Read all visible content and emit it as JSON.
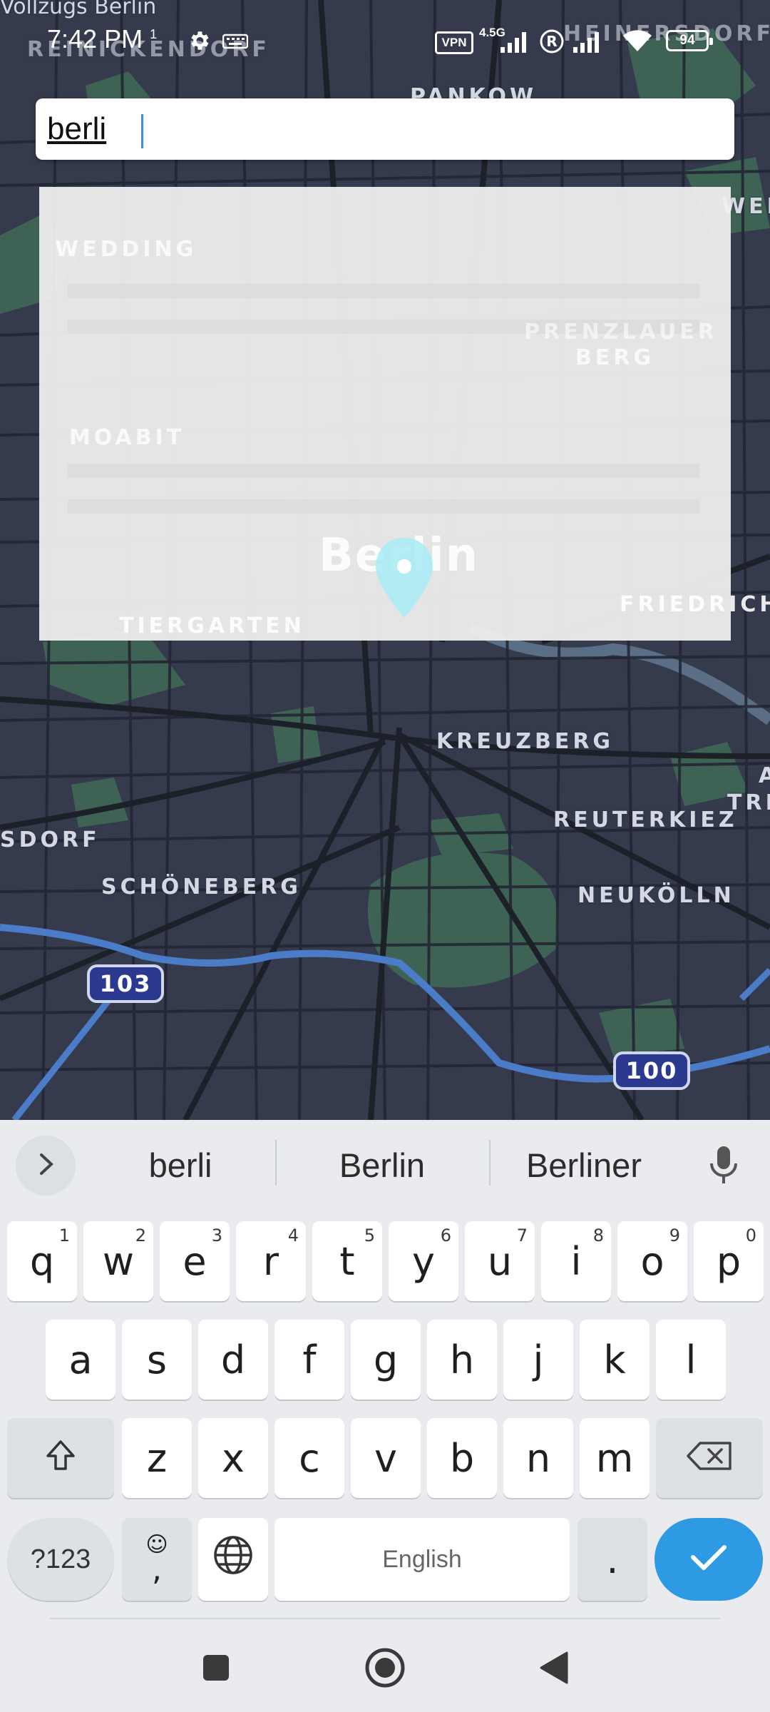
{
  "status_bar": {
    "time": "7:42 PM",
    "notif_badge": "1",
    "vpn_label": "VPN",
    "network_type": "4.5G",
    "battery_level": "94",
    "icons": [
      "settings-icon",
      "keyboard-icon",
      "signal-icon",
      "roaming-icon",
      "signal-icon",
      "wifi-icon",
      "battery-icon"
    ]
  },
  "map": {
    "labels": {
      "top": "Vollzugs Berlin",
      "reinickendorf": "REINICKENDORF",
      "pankow": "PANKOW",
      "heinersdorf": "HEINERSDORF",
      "wei": "WEI",
      "wedding": "WEDDING",
      "prenzlauer": "PRENZLAUER",
      "berg": "BERG",
      "moabit": "MOABIT",
      "berlin": "Berlin",
      "friedrichs": "FRIEDRICHS",
      "tiergarten": "TIERGARTEN",
      "kreuzberg": "KREUZBERG",
      "reuterkiez": "REUTERKIEZ",
      "dorf": "SDORF",
      "schoneberg": "SCHÖNEBERG",
      "neukolln": "NEUKÖLLN",
      "edge_a": "A",
      "edge_tre": "TRE"
    },
    "route_shields": [
      "103",
      "100"
    ],
    "colors": {
      "background": "#353b4c",
      "park": "#3f6b57",
      "highway": "#4a7cc7",
      "pin": "#a8ecf5"
    }
  },
  "search": {
    "value": "berli",
    "placeholder": ""
  },
  "keyboard": {
    "suggestions": [
      "berli",
      "Berlin",
      "Berliner"
    ],
    "row1": [
      {
        "key": "q",
        "num": "1"
      },
      {
        "key": "w",
        "num": "2"
      },
      {
        "key": "e",
        "num": "3"
      },
      {
        "key": "r",
        "num": "4"
      },
      {
        "key": "t",
        "num": "5"
      },
      {
        "key": "y",
        "num": "6"
      },
      {
        "key": "u",
        "num": "7"
      },
      {
        "key": "i",
        "num": "8"
      },
      {
        "key": "o",
        "num": "9"
      },
      {
        "key": "p",
        "num": "0"
      }
    ],
    "row2": [
      "a",
      "s",
      "d",
      "f",
      "g",
      "h",
      "j",
      "k",
      "l"
    ],
    "row3": [
      "z",
      "x",
      "c",
      "v",
      "b",
      "n",
      "m"
    ],
    "symbols_label": "?123",
    "emoji_comma_label": ",",
    "space_label": "English",
    "period_label": ".",
    "accent_color": "#2d9ae3"
  },
  "nav_bar": {
    "icons": [
      "recents-square-icon",
      "home-circle-icon",
      "back-triangle-icon"
    ]
  }
}
